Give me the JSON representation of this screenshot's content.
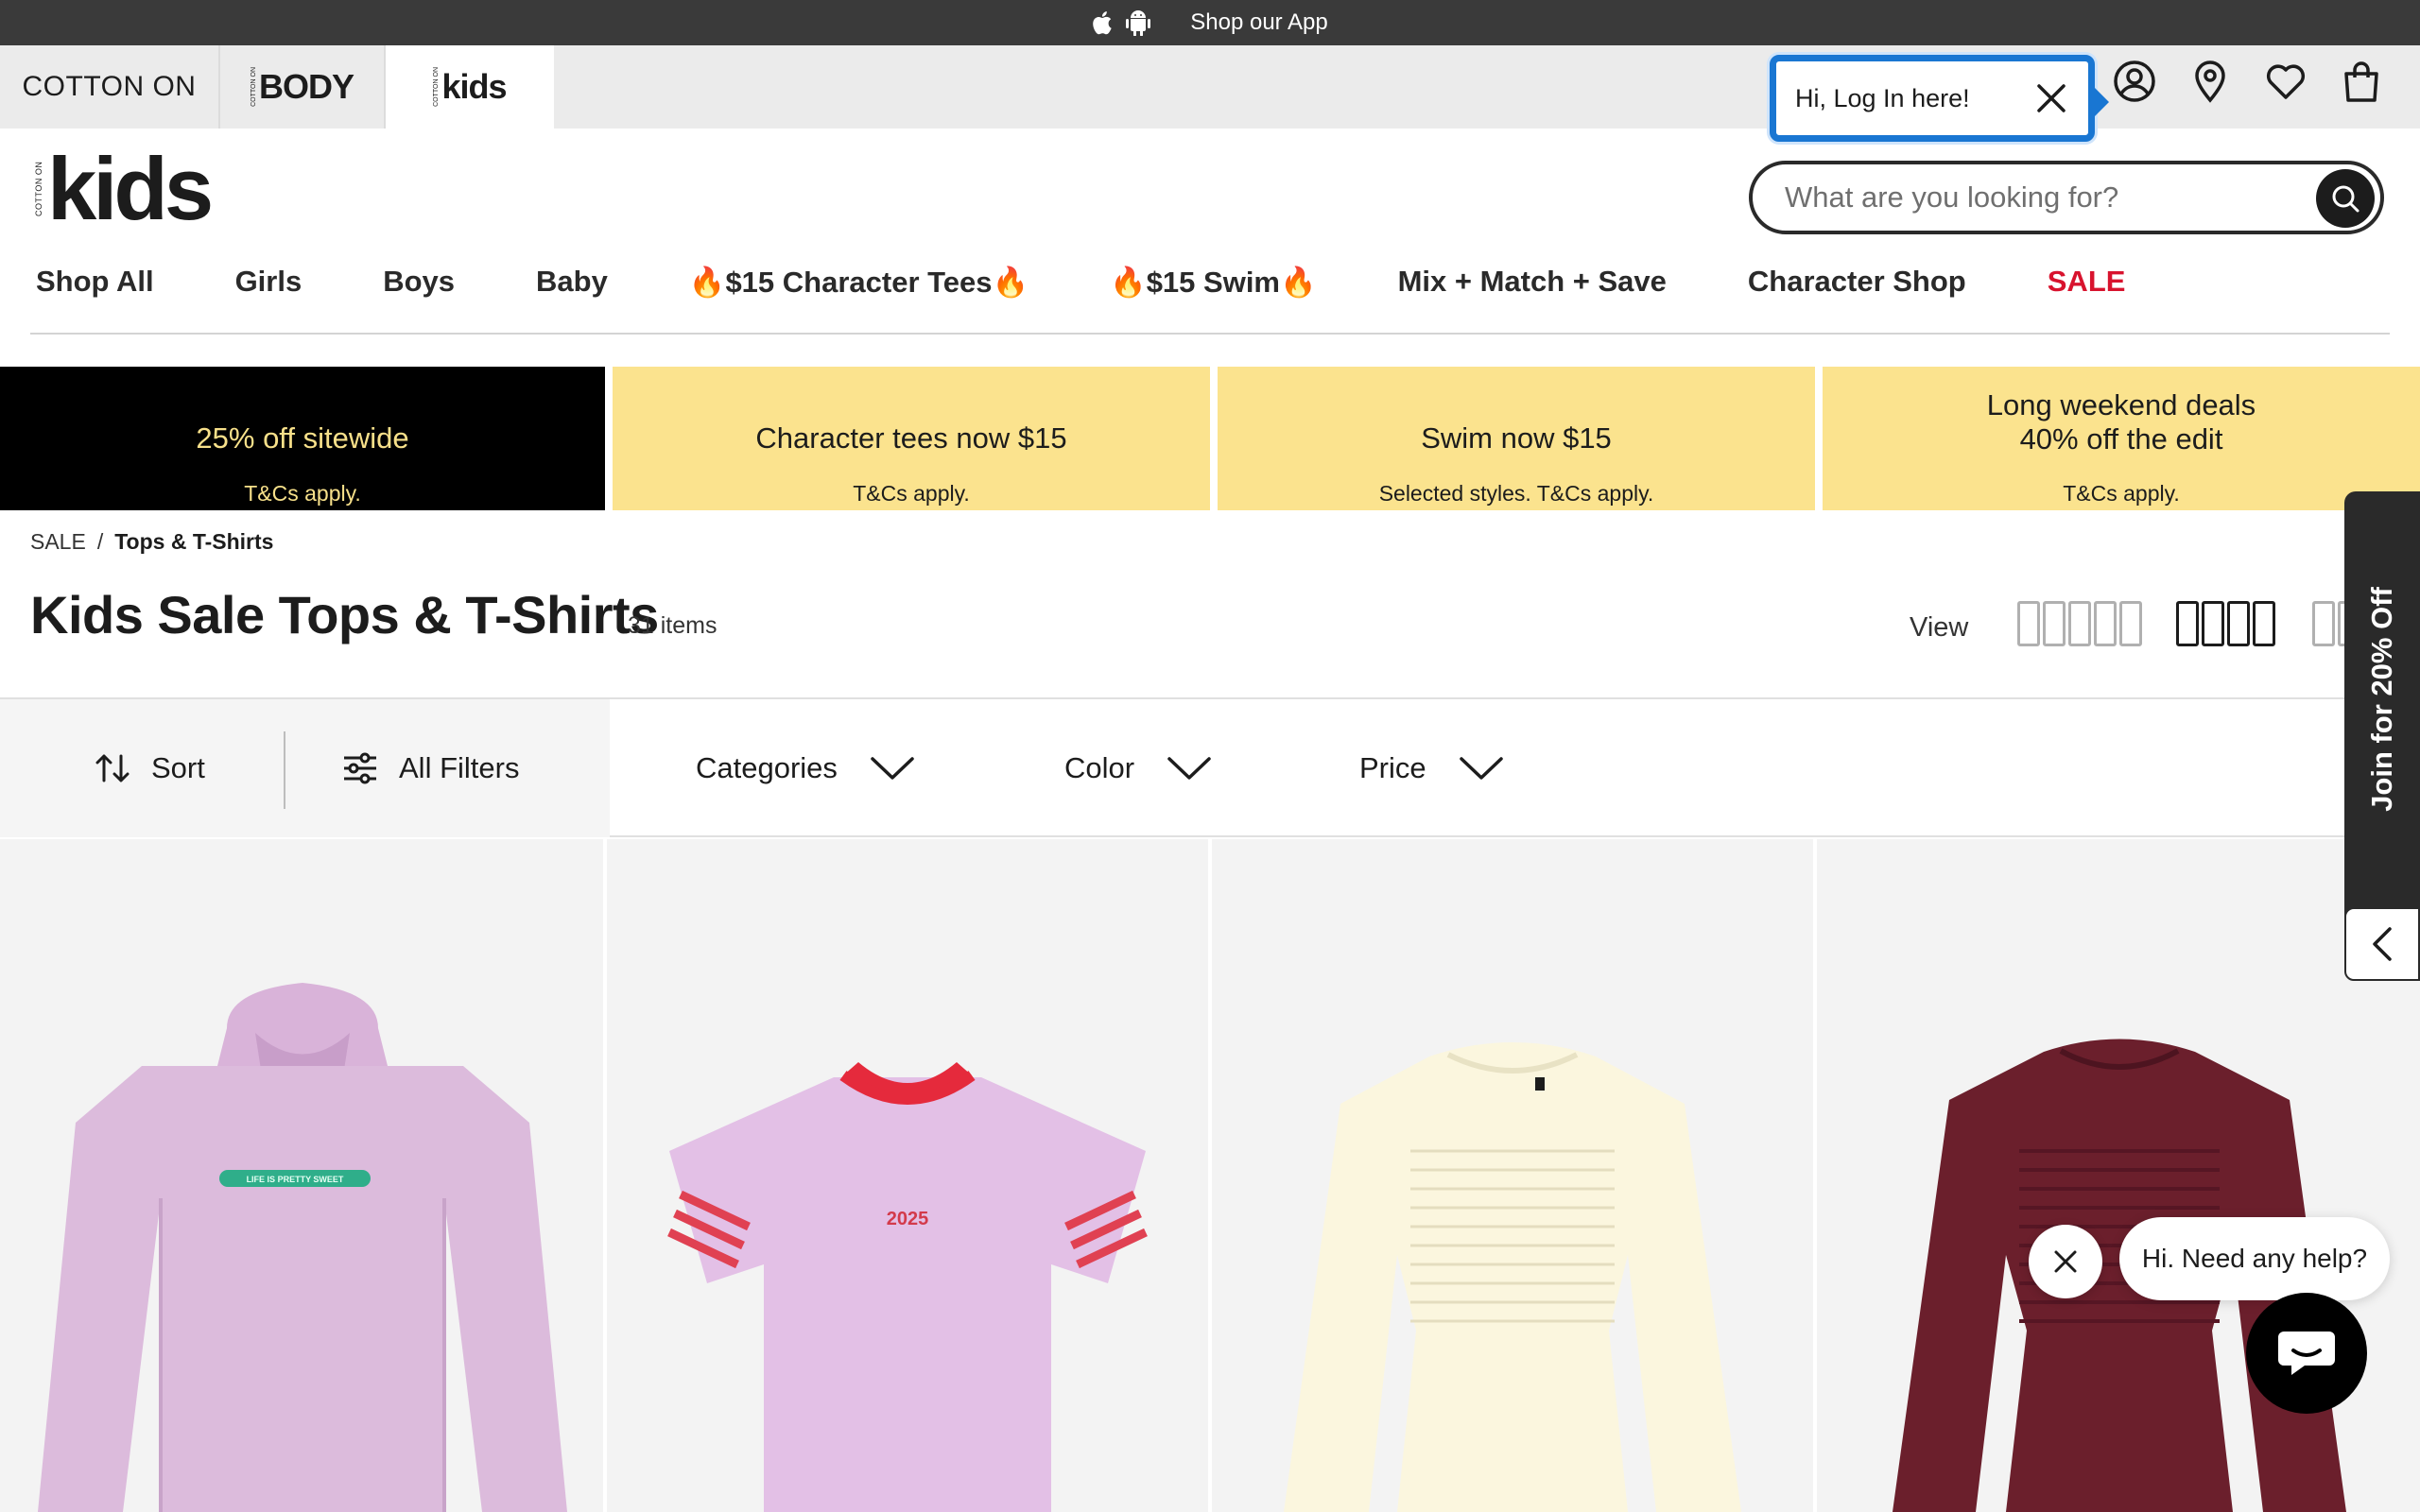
{
  "app_bar": {
    "label": "Shop our App"
  },
  "brand_tabs": [
    {
      "label": "COTTON ON"
    },
    {
      "label": "BODY",
      "mini": "COTTON ON"
    },
    {
      "label": "kids",
      "mini": "COTTON ON"
    }
  ],
  "login_popup": {
    "text": "Hi, Log In here!"
  },
  "logo": {
    "mini": "COTTON ON",
    "big": "kids"
  },
  "search": {
    "placeholder": "What are you looking for?"
  },
  "nav": [
    {
      "label": "Shop All"
    },
    {
      "label": "Girls"
    },
    {
      "label": "Boys"
    },
    {
      "label": "Baby"
    },
    {
      "label": "🔥$15 Character Tees🔥"
    },
    {
      "label": "🔥$15 Swim🔥"
    },
    {
      "label": "Mix + Match + Save"
    },
    {
      "label": "Character Shop"
    },
    {
      "label": "SALE"
    }
  ],
  "promos": [
    {
      "headline": "25% off sitewide",
      "sub": "T&Cs apply."
    },
    {
      "headline": "Character tees now $15",
      "sub": "T&Cs apply."
    },
    {
      "headline": "Swim now $15",
      "sub": "Selected styles. T&Cs apply."
    },
    {
      "headline": "Long weekend deals",
      "headline2": "40% off the edit",
      "sub": "T&Cs apply."
    }
  ],
  "breadcrumb": {
    "root": "SALE",
    "sep": "/",
    "current": "Tops & T-Shirts"
  },
  "page": {
    "title": "Kids Sale Tops & T-Shirts",
    "count": "31 items",
    "view_label": "View"
  },
  "filters": {
    "sort": "Sort",
    "all_filters": "All Filters",
    "dropdowns": [
      "Categories",
      "Color",
      "Price"
    ]
  },
  "products": [
    {
      "print_text": "LIFE IS PRETTY SWEET"
    },
    {
      "print_text": "2025"
    },
    {
      "print_text": ""
    },
    {
      "print_text": ""
    }
  ],
  "side_promo": {
    "label": "Join for 20% Off"
  },
  "chat": {
    "bubble": "Hi. Need any help?"
  },
  "colors": {
    "sale": "#d8132e",
    "promo_yellow": "#fbe38e",
    "promo_black_text": "#f7e08a",
    "login_border": "#1976d2"
  }
}
